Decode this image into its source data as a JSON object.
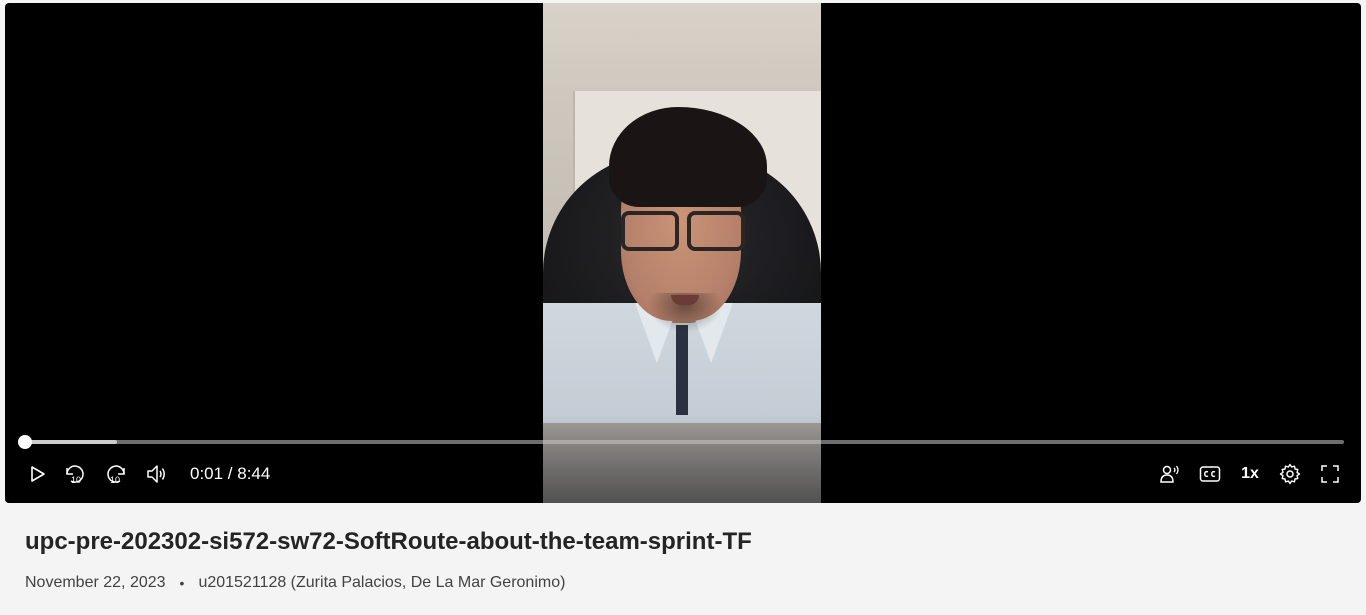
{
  "player": {
    "time_display": "0:01 / 8:44",
    "progress": {
      "played_fraction": 0.0,
      "buffered_fraction": 0.07
    },
    "controls": {
      "play": "play-icon",
      "rewind_10": "rewind-10-icon",
      "forward_10": "forward-10-icon",
      "volume": "volume-icon",
      "audio_description": "audio-description-icon",
      "captions": "closed-captions-icon",
      "speed_label": "1x",
      "settings": "gear-icon",
      "fullscreen": "fullscreen-icon",
      "skip_label": "10"
    }
  },
  "video": {
    "title": "upc-pre-202302-si572-sw72-SoftRoute-about-the-team-sprint-TF",
    "date": "November 22, 2023",
    "separator": "•",
    "author": "u201521128 (Zurita Palacios, De La Mar Geronimo)"
  },
  "colors": {
    "page_background": "#f4f4f4",
    "player_background": "#000000",
    "title_text": "#242424",
    "meta_text": "#424242"
  }
}
